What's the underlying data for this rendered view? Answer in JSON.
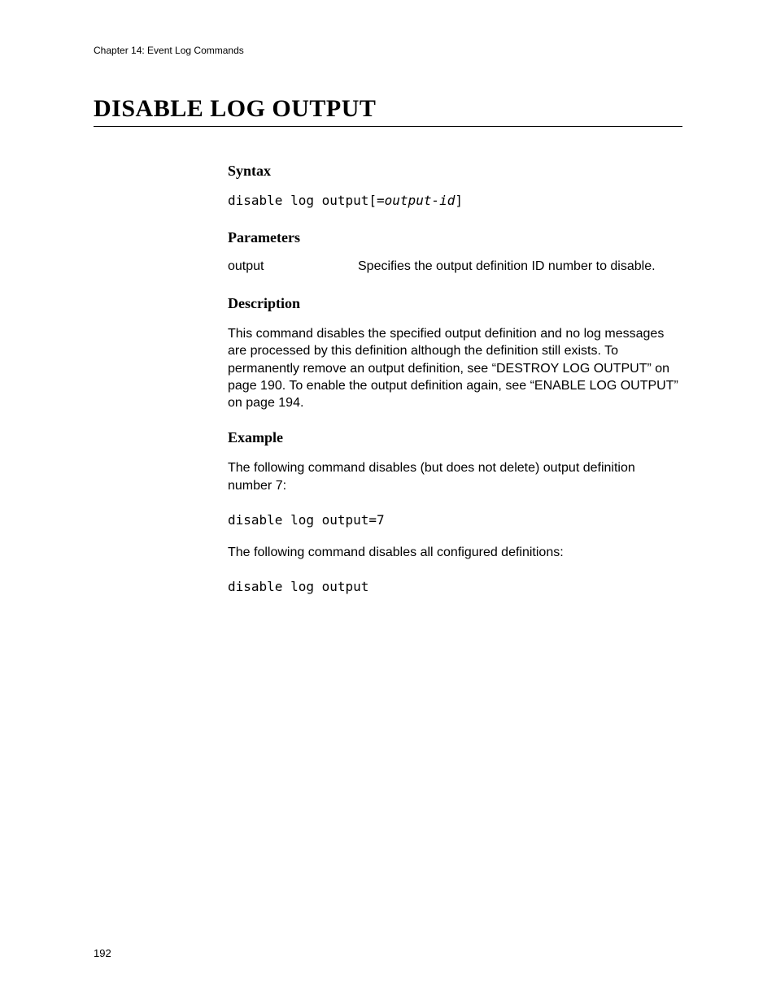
{
  "header": {
    "chapter": "Chapter 14: Event Log Commands"
  },
  "title": "DISABLE LOG OUTPUT",
  "sections": {
    "syntax": {
      "heading": "Syntax",
      "cmd_prefix": "disable log output[=",
      "cmd_param": "output-id",
      "cmd_suffix": "]"
    },
    "parameters": {
      "heading": "Parameters",
      "rows": [
        {
          "name": "output",
          "desc": "Specifies the output definition ID number to disable."
        }
      ]
    },
    "description": {
      "heading": "Description",
      "text": "This command disables the specified output definition and no log messages are processed by this definition although the definition still exists. To permanently remove an output definition, see “DESTROY LOG OUTPUT” on page 190. To enable the output definition again, see “ENABLE LOG OUTPUT” on page 194."
    },
    "example": {
      "heading": "Example",
      "intro1": "The following command disables (but does not delete) output definition number 7:",
      "code1": "disable log output=7",
      "intro2": "The following command disables all configured definitions:",
      "code2": "disable log output"
    }
  },
  "page_number": "192"
}
